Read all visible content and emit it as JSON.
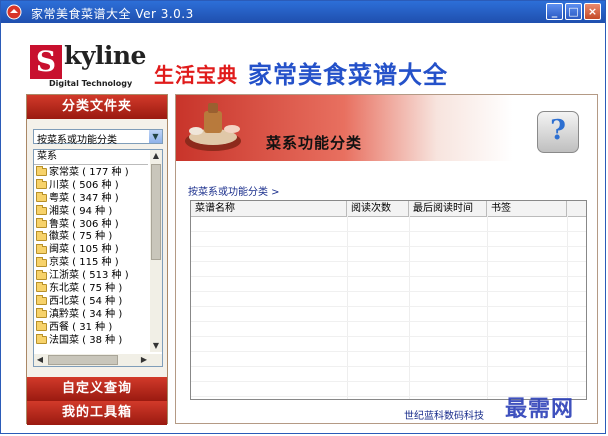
{
  "window": {
    "title": "家常美食菜谱大全 Ver 3.0.3",
    "min_label": "_",
    "max_label": "□",
    "close_label": "×"
  },
  "header": {
    "logo_letter": "S",
    "logo_word": "kyline",
    "logo_sub": "Digital Technology",
    "brand_left": "生活宝典",
    "brand_right": "家常美食菜谱大全"
  },
  "sidebar": {
    "section_top": "分类文件夹",
    "combo_value": "按菜系或功能分类",
    "list_header": "菜系",
    "items": [
      "家常菜 ( 177 种 )",
      "川菜 ( 506 种 )",
      "粤菜 ( 347 种 )",
      "湘菜 ( 94 种 )",
      "鲁菜 ( 306 种 )",
      "徽菜 ( 75 种 )",
      "闽菜 ( 105 种 )",
      "京菜 ( 115 种 )",
      "江浙菜 ( 513 种 )",
      "东北菜 ( 75 种 )",
      "西北菜 ( 54 种 )",
      "滇黔菜 ( 34 种 )",
      "西餐 ( 31 种 )",
      "法国菜 ( 38 种 )"
    ],
    "section_mid": "自定义查询",
    "section_bottom": "我的工具箱"
  },
  "main": {
    "banner_title": "菜系功能分类",
    "help_glyph": "?",
    "breadcrumb": "按菜系或功能分类 >",
    "columns": [
      "菜谱名称",
      "阅读次数",
      "最后阅读时间",
      "书签"
    ],
    "footer_text": "世纪蓝科数码科技"
  },
  "watermark": "最需网",
  "colors": {
    "title_bar": "#2d6fd8",
    "section_red": "#c0281c",
    "brand_red": "#e01b1b",
    "brand_blue": "#2451c9"
  }
}
